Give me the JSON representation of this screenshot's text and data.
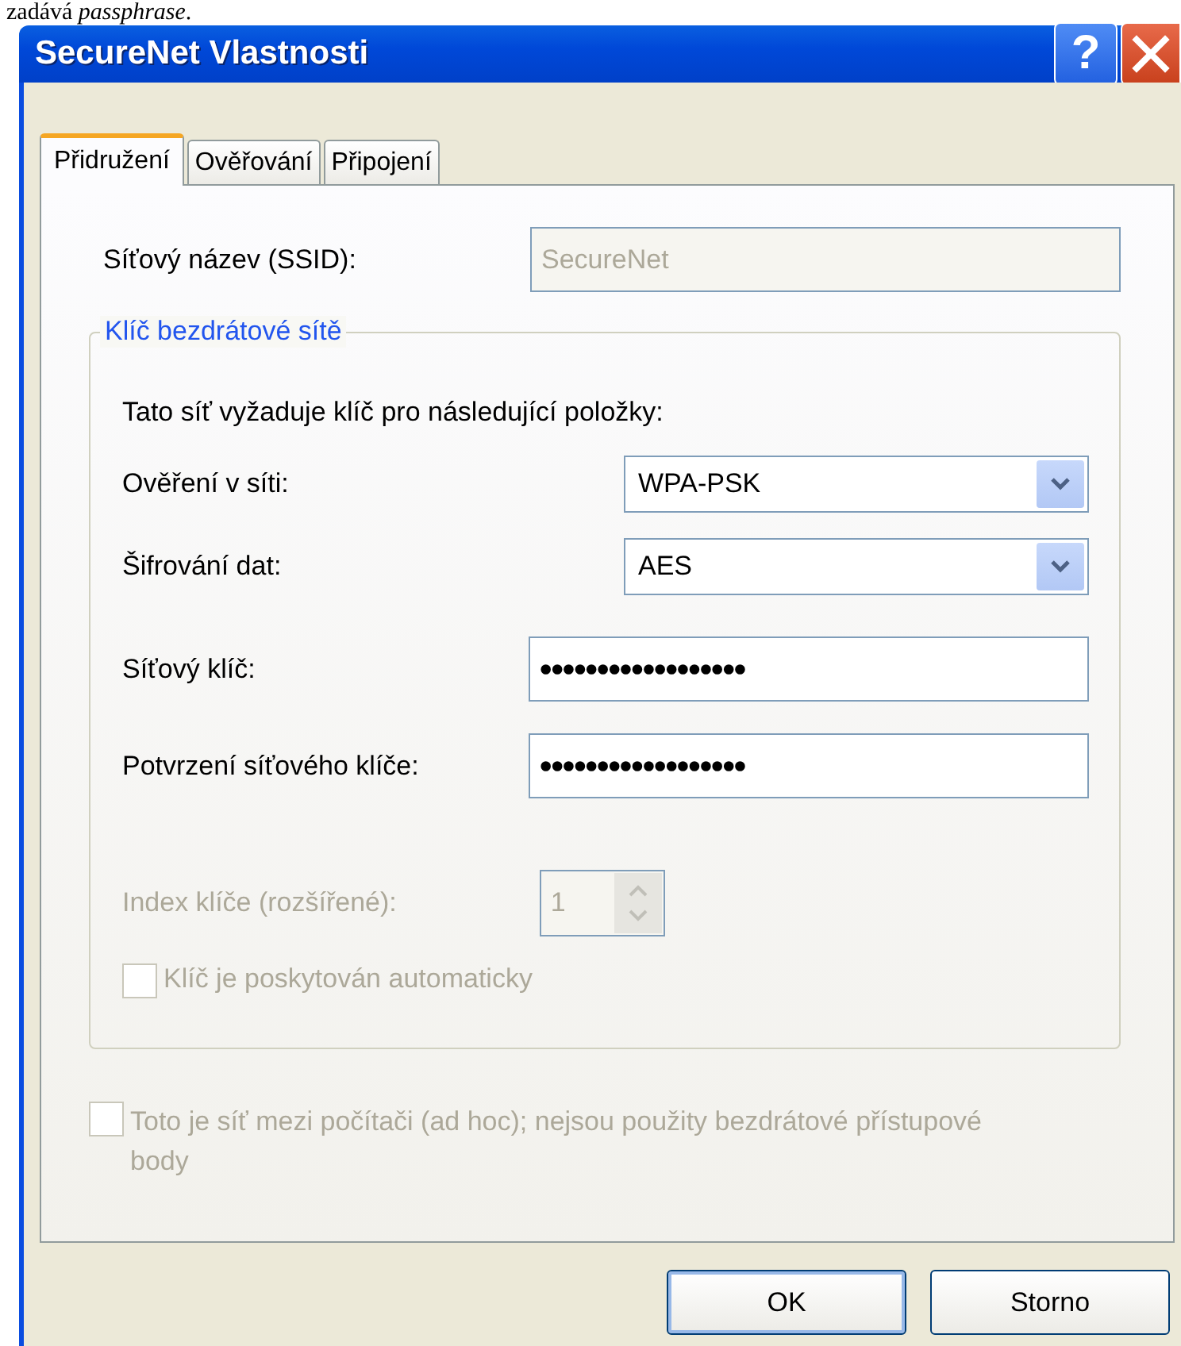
{
  "caption": {
    "text": "zadává *passphrase*."
  },
  "window": {
    "title": "SecureNet Vlastnosti",
    "help": "?"
  },
  "tabs": [
    {
      "label": "Přidružení",
      "selected": true
    },
    {
      "label": "Ověřování",
      "selected": false
    },
    {
      "label": "Připojení",
      "selected": false
    }
  ],
  "ssid": {
    "label": "Síťový název (SSID):",
    "value": "SecureNet",
    "disabled": true
  },
  "key_group": {
    "legend": "Klíč bezdrátové sítě",
    "intro": "Tato síť vyžaduje klíč pro následující položky:",
    "rows": [
      {
        "kind": "dropdown",
        "label": "Ověření v síti:",
        "value": "WPA-PSK"
      },
      {
        "kind": "dropdown",
        "label": "Šifrování dat:",
        "value": "AES"
      },
      {
        "kind": "password",
        "label": "Síťový klíč:",
        "value": "••••••••••••••••••"
      },
      {
        "kind": "password",
        "label": "Potvrzení síťového klíče:",
        "value": "••••••••••••••••••"
      }
    ],
    "index": {
      "label": "Index klíče (rozšířené):",
      "value": "1",
      "disabled": true
    },
    "auto_key": {
      "label": "Klíč je poskytován automaticky",
      "checked": false,
      "disabled": true
    }
  },
  "adhoc": {
    "label": "Toto je síť mezi počítači (ad hoc); nejsou použity bezdrátové přístupové body",
    "checked": false,
    "disabled": true
  },
  "buttons": [
    {
      "label": "OK",
      "default": true
    },
    {
      "label": "Storno",
      "default": false
    }
  ]
}
